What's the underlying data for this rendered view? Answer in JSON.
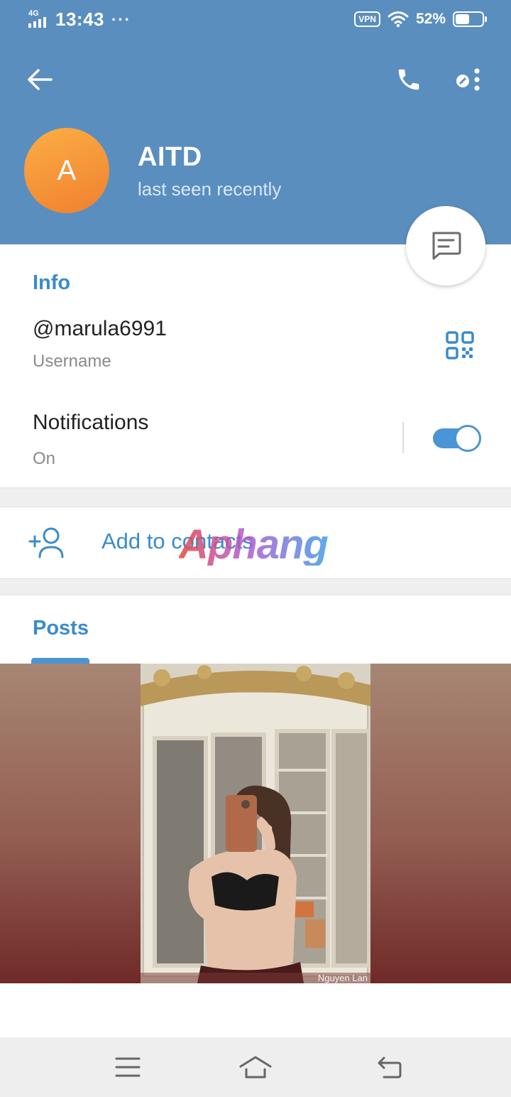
{
  "status_bar": {
    "network": "4G",
    "time": "13:43",
    "more": "···",
    "vpn": "VPN",
    "battery_percent": "52%",
    "battery_level": 0.52
  },
  "toolbar": {
    "back_icon": "arrow-left-icon",
    "call_icon": "phone-icon",
    "more_icon": "more-options-icon"
  },
  "profile": {
    "avatar_letter": "A",
    "avatar_color": "#f48d38",
    "name": "AITD",
    "status": "last seen recently",
    "message_icon": "message-bubble-icon"
  },
  "info": {
    "title": "Info",
    "username": "@marula6991",
    "username_label": "Username",
    "qr_icon": "qr-code-icon",
    "notifications_label": "Notifications",
    "notifications_value": "On",
    "notifications_enabled": true
  },
  "add_contact": {
    "label": "Add to contacts",
    "icon": "add-person-icon"
  },
  "watermark": {
    "text": "Aphang"
  },
  "posts": {
    "tab_label": "Posts",
    "photo_credit": "Nguyen Lan"
  },
  "navbar": {
    "menu_icon": "menu-icon",
    "home_icon": "home-icon",
    "back_icon": "back-icon"
  },
  "colors": {
    "header": "#5a8ebf",
    "accent": "#3a8bcb",
    "toggle": "#4a95d6"
  }
}
